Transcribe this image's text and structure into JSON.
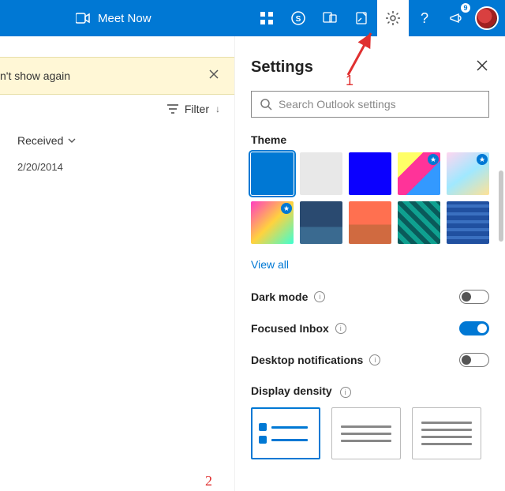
{
  "topbar": {
    "meet_label": "Meet Now",
    "notification_count": "9"
  },
  "left": {
    "dismiss_label": "n't show again",
    "filter_label": "Filter",
    "group_label": "Received",
    "date": "2/20/2014"
  },
  "annotations": {
    "a1": "1",
    "a2": "2"
  },
  "settings": {
    "title": "Settings",
    "search_placeholder": "Search Outlook settings",
    "theme_label": "Theme",
    "view_all": "View all",
    "dark_mode": "Dark mode",
    "focused_inbox": "Focused Inbox",
    "desktop_notifications": "Desktop notifications",
    "display_density": "Display density",
    "toggles": {
      "dark_mode": false,
      "focused_inbox": true,
      "desktop_notifications": false
    }
  }
}
